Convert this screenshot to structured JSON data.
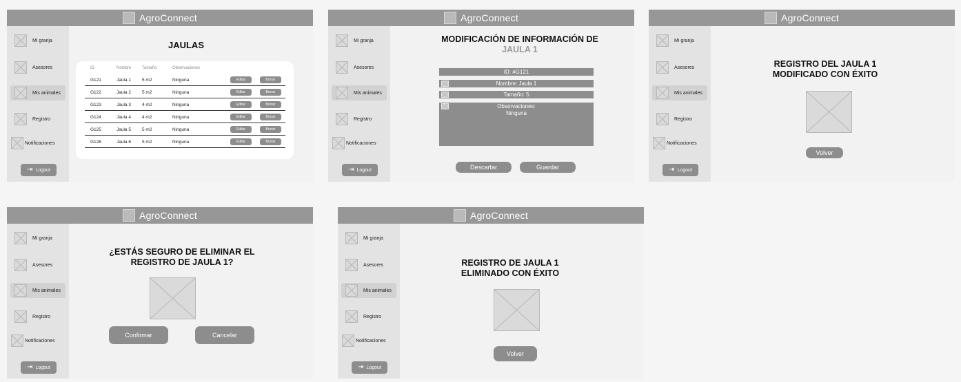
{
  "app": {
    "title": "AgroConnect"
  },
  "sidebar": {
    "items": [
      {
        "label": "Mi granja"
      },
      {
        "label": "Asesores"
      },
      {
        "label": "Mis animales"
      },
      {
        "label": "Registro"
      },
      {
        "label": "Notificaciones"
      }
    ],
    "logout_label": "Logout"
  },
  "screens": {
    "jaulas": {
      "title": "JAULAS",
      "columns": [
        "ID",
        "Nombre",
        "Tamaño",
        "Observaciones"
      ],
      "rows": [
        {
          "id": "G121",
          "nombre": "Jaula 1",
          "tamano": "5 m2",
          "obs": "Ninguna"
        },
        {
          "id": "G122",
          "nombre": "Jaula 2",
          "tamano": "5 m2",
          "obs": "Ninguna"
        },
        {
          "id": "G123",
          "nombre": "Jaula 3",
          "tamano": "4 m2",
          "obs": "Ninguna"
        },
        {
          "id": "G124",
          "nombre": "Jaula 4",
          "tamano": "4 m2",
          "obs": "Ninguna"
        },
        {
          "id": "G125",
          "nombre": "Jaula 5",
          "tamano": "5 m2",
          "obs": "Ninguna"
        },
        {
          "id": "G126",
          "nombre": "Jaula 6",
          "tamano": "5 m2",
          "obs": "Ninguna"
        }
      ],
      "edit_label": "Editar",
      "delete_label": "Borrar"
    },
    "modificacion": {
      "title_line1": "MODIFICACIÓN DE INFORMACIÓN DE",
      "title_line2": "JAULA 1",
      "id_field": "ID: #G121",
      "nombre_field": "Nombre: Jaula 1",
      "tamano_field": "Tamaño: 5",
      "obs_label": "Observaciones:",
      "obs_value": "Ninguna",
      "discard_label": "Descartar",
      "save_label": "Guardar"
    },
    "modificado": {
      "title_line1": "REGISTRO DEL JAULA 1",
      "title_line2": "MODIFICADO CON ÉXITO",
      "back_label": "Volver"
    },
    "confirmar": {
      "title_line1": "¿ESTÁS SEGURO DE ELIMINAR EL",
      "title_line2": "REGISTRO DE JAULA 1?",
      "confirm_label": "Confirmar",
      "cancel_label": "Cancelar"
    },
    "eliminado": {
      "title_line1": "REGISTRO DE JAULA 1",
      "title_line2": "ELIMINADO CON ÉXITO",
      "back_label": "Volver"
    }
  }
}
